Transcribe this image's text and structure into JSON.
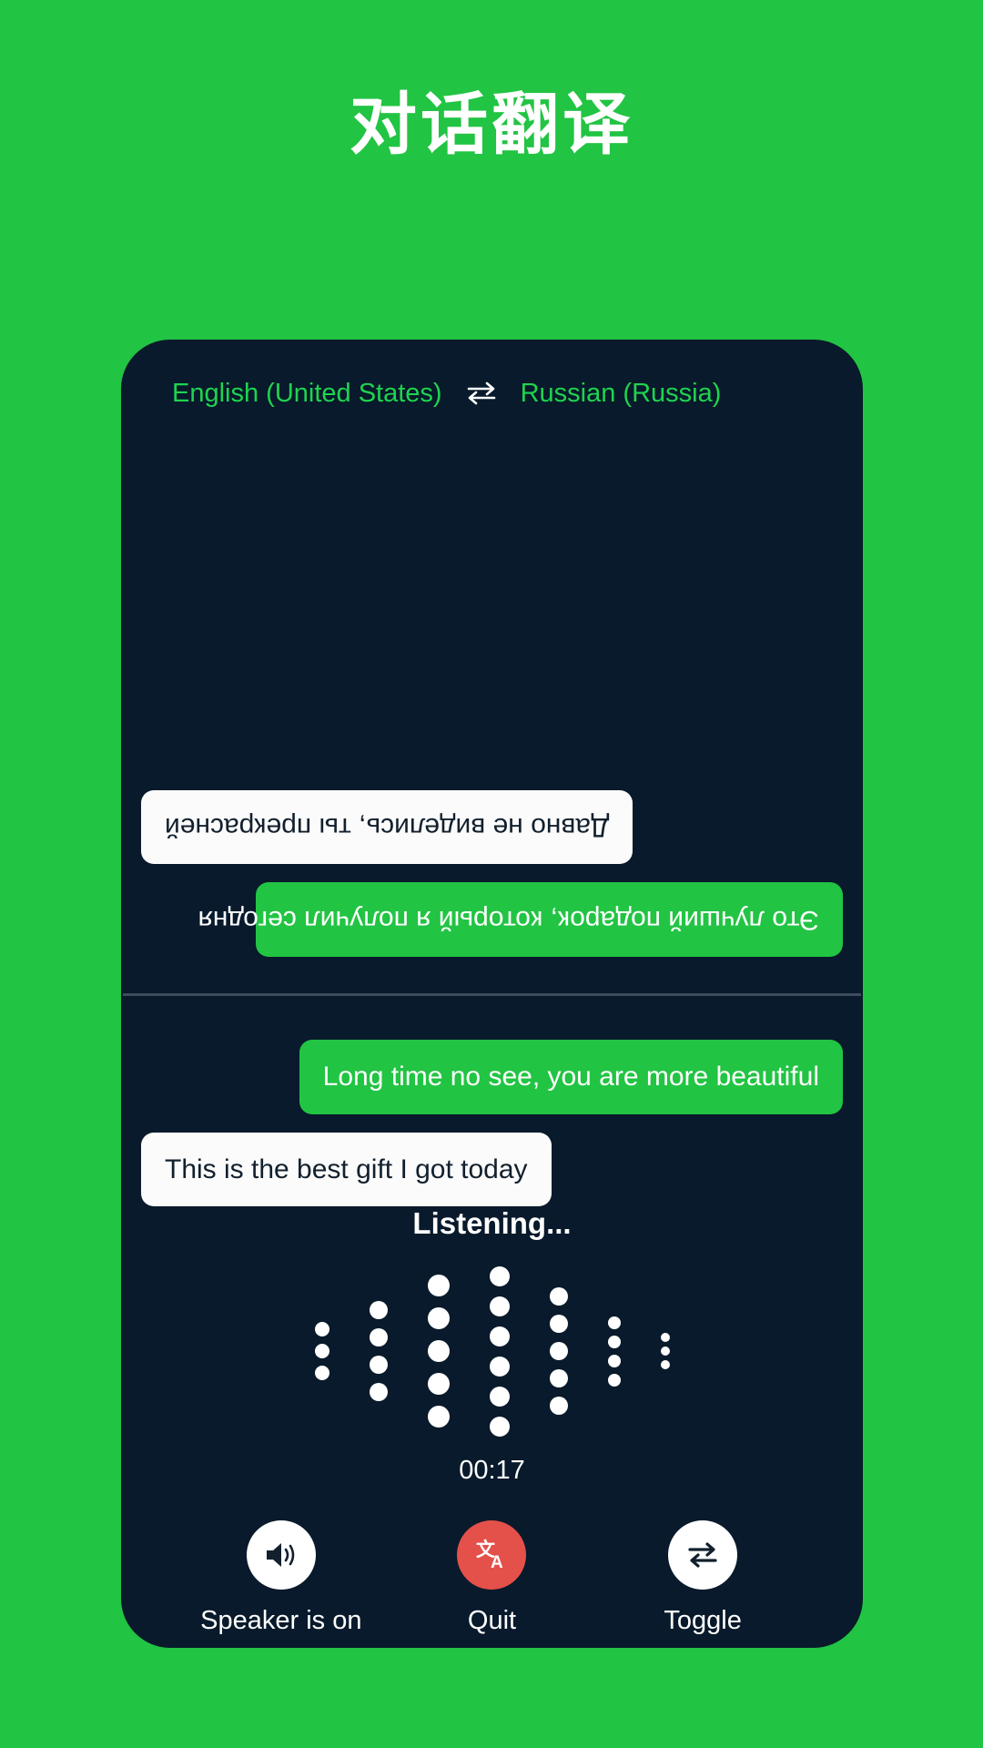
{
  "page": {
    "title": "对话翻译",
    "background_color": "#22c443"
  },
  "colors": {
    "brand_green": "#22c443",
    "card_dark": "#081a2b",
    "lang_green": "#1fd34f",
    "quit_red": "#e4504a",
    "bubble_white": "#fbfbfb",
    "divider": "#3e4d5c"
  },
  "language_bar": {
    "source_language": "English (United States)",
    "swap_icon": "swap-horizontal-icon",
    "target_language": "Russian (Russia)"
  },
  "conversation": {
    "remote_messages": [
      {
        "text": "Это лучший подарок, который я получил сегодня",
        "style": "green",
        "align": "left"
      },
      {
        "text": "Давно не виделись, ты прекрасней",
        "style": "white",
        "align": "right"
      }
    ],
    "local_messages": [
      {
        "text": "Long time no see, you are more beautiful",
        "style": "green",
        "align": "right"
      },
      {
        "text": "This is the best gift I got today",
        "style": "white",
        "align": "left"
      }
    ]
  },
  "status": {
    "listening_label": "Listening...",
    "timer": "00:17"
  },
  "waveform": {
    "columns": [
      {
        "dots": 3,
        "size": 16
      },
      {
        "dots": 4,
        "size": 20
      },
      {
        "dots": 5,
        "size": 24
      },
      {
        "dots": 6,
        "size": 22
      },
      {
        "dots": 5,
        "size": 20
      },
      {
        "dots": 4,
        "size": 14
      },
      {
        "dots": 3,
        "size": 10
      }
    ]
  },
  "controls": [
    {
      "label": "Speaker is on",
      "icon": "speaker-on-icon",
      "circle": "white"
    },
    {
      "label": "Quit",
      "icon": "translate-icon",
      "circle": "red"
    },
    {
      "label": "Toggle",
      "icon": "toggle-swap-icon",
      "circle": "white"
    }
  ]
}
